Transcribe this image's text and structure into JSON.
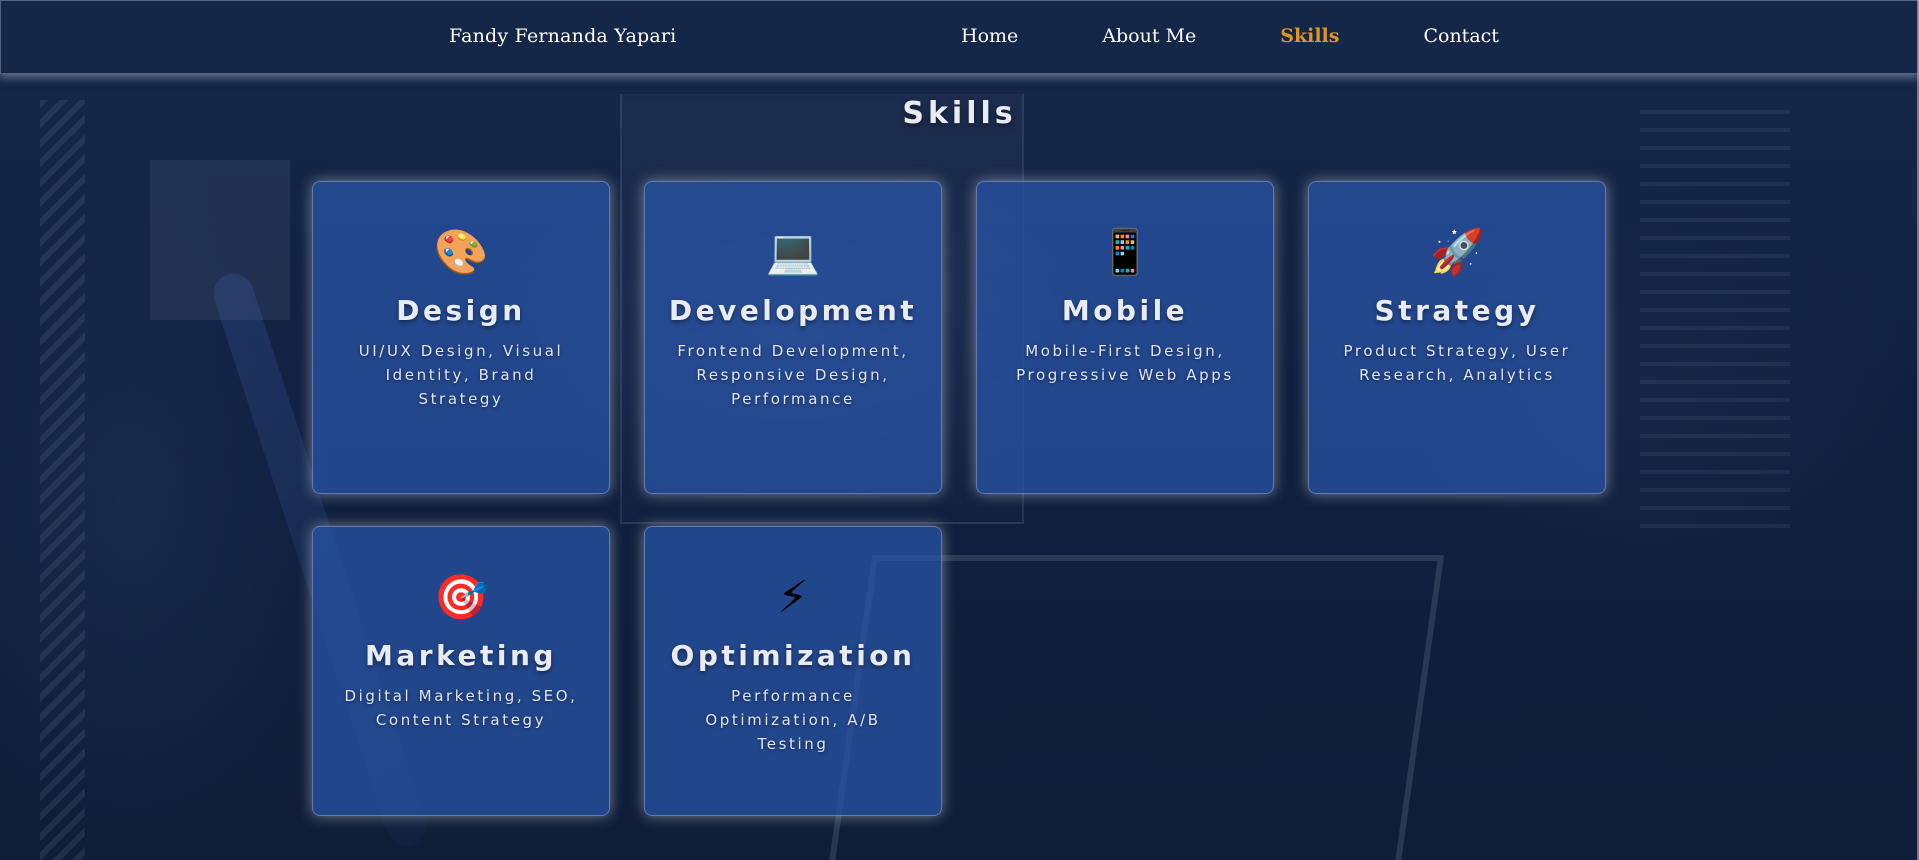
{
  "nav": {
    "brand": "Fandy Fernanda Yapari",
    "links": [
      {
        "label": "Home",
        "active": false
      },
      {
        "label": "About Me",
        "active": false
      },
      {
        "label": "Skills",
        "active": true
      },
      {
        "label": "Contact",
        "active": false
      }
    ]
  },
  "section": {
    "title": "Skills"
  },
  "skills": [
    {
      "icon": "🎨",
      "icon_name": "palette-icon",
      "name": "Design",
      "description": "UI/UX Design, Visual Identity, Brand Strategy"
    },
    {
      "icon": "💻",
      "icon_name": "laptop-icon",
      "name": "Development",
      "description": "Frontend Development, Responsive Design, Performance"
    },
    {
      "icon": "📱",
      "icon_name": "mobile-phone-icon",
      "name": "Mobile",
      "description": "Mobile-First Design, Progressive Web Apps"
    },
    {
      "icon": "🚀",
      "icon_name": "rocket-icon",
      "name": "Strategy",
      "description": "Product Strategy, User Research, Analytics"
    },
    {
      "icon": "🎯",
      "icon_name": "target-icon",
      "name": "Marketing",
      "description": "Digital Marketing, SEO, Content Strategy"
    },
    {
      "icon": "⚡",
      "icon_name": "lightning-icon",
      "name": "Optimization",
      "description": "Performance Optimization, A/B Testing"
    }
  ],
  "colors": {
    "nav_background": "#142748",
    "active_link": "#e0961f",
    "card_background": "#2a56aa",
    "page_background": "#132340"
  }
}
